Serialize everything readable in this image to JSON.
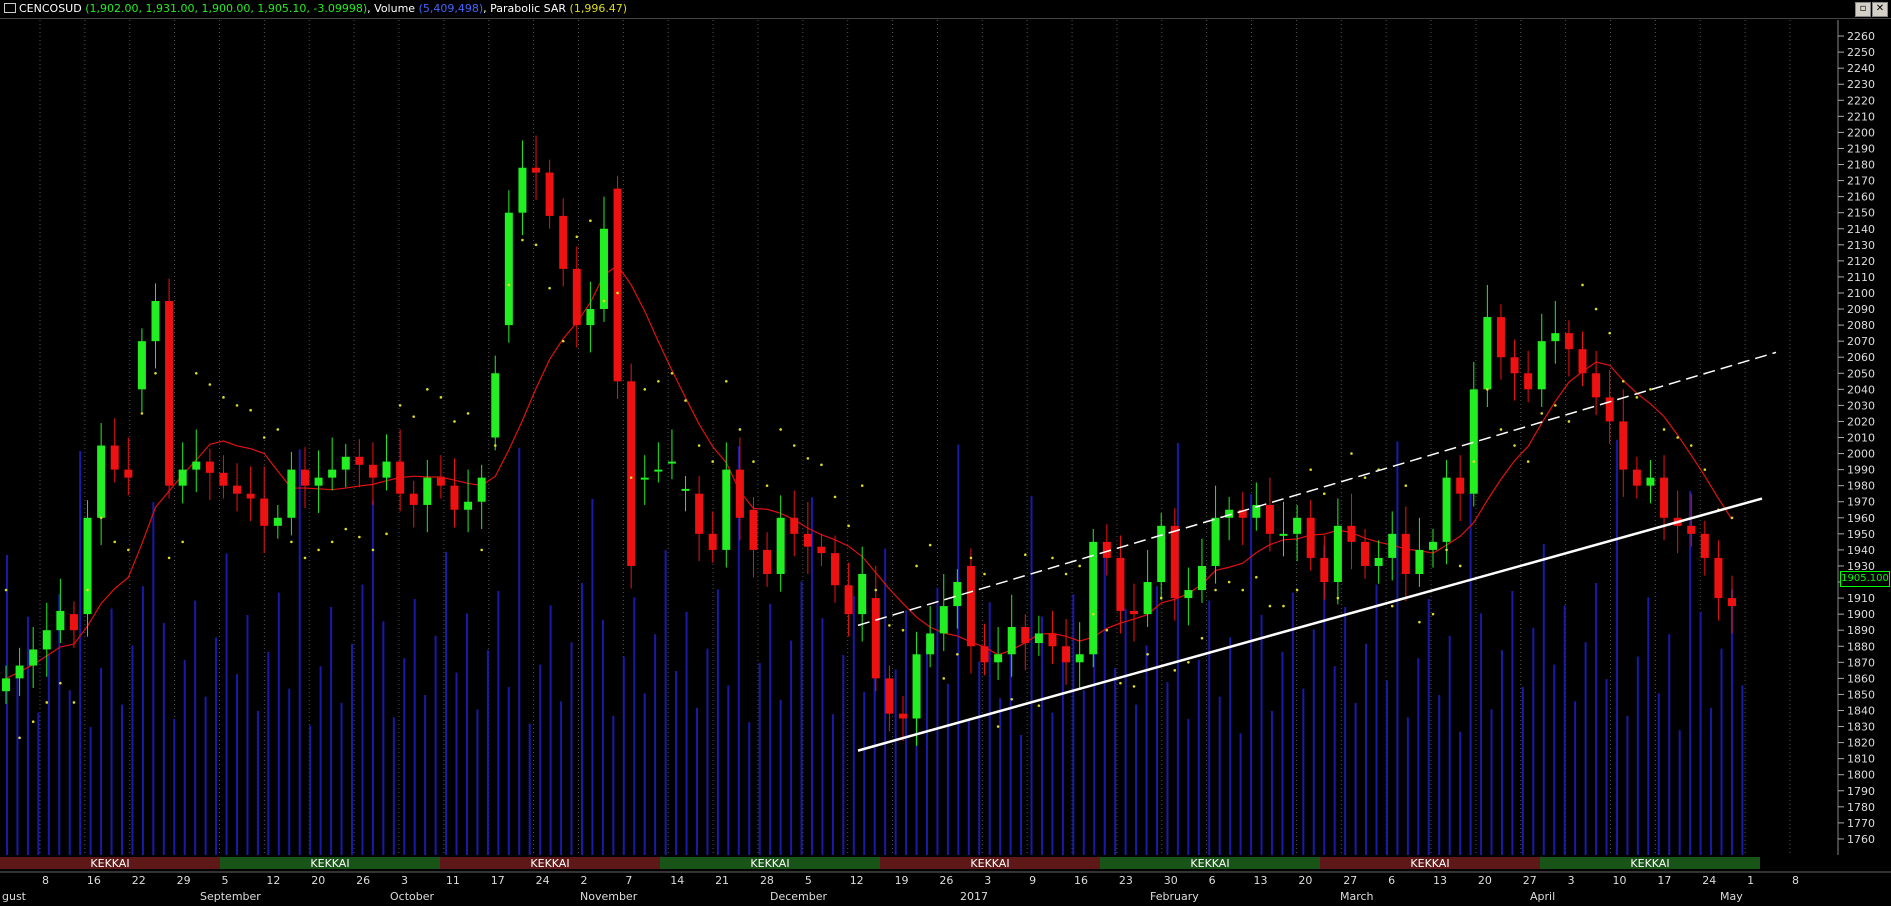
{
  "window": {
    "symbol": "CENCOSUD",
    "ohlc_text": "(1,902.00, 1,931.00, 1,900.00, 1,905.10, -3.09998)",
    "volume_label": "Volume",
    "volume_value": "(5,409,498)",
    "sar_label": "Parabolic SAR",
    "sar_value": "(1,996.47)",
    "close_icon": "close-icon",
    "restore_icon": "restore-icon"
  },
  "price_tag": "1905.100",
  "colors": {
    "up": "#22ee22",
    "down": "#ee1111",
    "blue": "#2222ff",
    "volume": "#1a1aaa",
    "ma": "#dd1111",
    "sar": "#dddd22",
    "trend": "#ffffff",
    "grid": "#555555",
    "kekkai_green": "#1d7a1d",
    "kekkai_red": "#8a1d1d"
  },
  "chart_data": {
    "type": "candlestick",
    "ylim": [
      1750,
      2270
    ],
    "y_ticks": [
      1760,
      1770,
      1780,
      1790,
      1800,
      1810,
      1820,
      1830,
      1840,
      1850,
      1860,
      1870,
      1880,
      1890,
      1900,
      1910,
      1920,
      1930,
      1940,
      1950,
      1960,
      1970,
      1980,
      1990,
      2000,
      2010,
      2020,
      2030,
      2040,
      2050,
      2060,
      2070,
      2080,
      2090,
      2100,
      2110,
      2120,
      2130,
      2140,
      2150,
      2160,
      2170,
      2180,
      2190,
      2200,
      2210,
      2220,
      2230,
      2240,
      2250,
      2260
    ],
    "x_day_ticks": [
      "8",
      "16",
      "22",
      "29",
      "5",
      "12",
      "20",
      "26",
      "3",
      "11",
      "17",
      "24",
      "2",
      "7",
      "14",
      "21",
      "28",
      "5",
      "12",
      "19",
      "26",
      "3",
      "9",
      "16",
      "23",
      "30",
      "6",
      "13",
      "20",
      "27",
      "6",
      "13",
      "20",
      "27",
      "3",
      "10",
      "17",
      "24",
      "1",
      "8"
    ],
    "x_month_ticks": [
      "gust",
      "September",
      "October",
      "November",
      "December",
      "2017",
      "February",
      "March",
      "April",
      "May"
    ],
    "kekkai_bands": [
      {
        "label": "KEKKAI",
        "color": "red"
      },
      {
        "label": "KEKKAI",
        "color": "green"
      },
      {
        "label": "KEKKAI",
        "color": "red"
      },
      {
        "label": "KEKKAI",
        "color": "green"
      },
      {
        "label": "KEKKAI",
        "color": "red"
      },
      {
        "label": "KEKKAI",
        "color": "green"
      },
      {
        "label": "KEKKAI",
        "color": "red"
      },
      {
        "label": "KEKKAI",
        "color": "green"
      }
    ],
    "series": [
      {
        "name": "CENCOSUD",
        "kind": "ohlc",
        "close": [
          1860,
          1868,
          1878,
          1890,
          1902,
          1890,
          1960,
          2005,
          1990,
          1985,
          2070,
          2095,
          1980,
          1990,
          1995,
          1988,
          1980,
          1975,
          1972,
          1955,
          1960,
          1990,
          1980,
          1985,
          1990,
          1998,
          1993,
          1985,
          1995,
          1975,
          1968,
          1985,
          1980,
          1965,
          1970,
          1985,
          2050,
          2150,
          2178,
          2175,
          2148,
          2115,
          2080,
          2090,
          2140,
          2045,
          1930,
          1985,
          1990,
          1995,
          1978,
          1950,
          1940,
          1990,
          1960,
          1940,
          1925,
          1960,
          1950,
          1942,
          1938,
          1918,
          1900,
          1925,
          1860,
          1838,
          1835,
          1875,
          1888,
          1905,
          1920,
          1880,
          1870,
          1875,
          1892,
          1882,
          1888,
          1880,
          1870,
          1875,
          1945,
          1935,
          1902,
          1900,
          1920,
          1955,
          1910,
          1915,
          1930,
          1960,
          1965,
          1960,
          1968,
          1950,
          1950,
          1960,
          1935,
          1920,
          1955,
          1945,
          1930,
          1935,
          1950,
          1925,
          1940,
          1945,
          1985,
          1975,
          2040,
          2085,
          2060,
          2050,
          2040,
          2070,
          2075,
          2065,
          2050,
          2035,
          2020,
          1990,
          1980,
          1985,
          1960,
          1955,
          1950,
          1935,
          1910,
          1905
        ],
        "open": [
          1852,
          1860,
          1868,
          1878,
          1890,
          1900,
          1900,
          1960,
          2005,
          1990,
          2040,
          2070,
          2095,
          1980,
          1990,
          1995,
          1988,
          1980,
          1975,
          1972,
          1955,
          1960,
          1990,
          1980,
          1985,
          1990,
          1998,
          1993,
          1985,
          1995,
          1975,
          1968,
          1985,
          1980,
          1965,
          1970,
          2010,
          2080,
          2150,
          2178,
          2175,
          2148,
          2115,
          2080,
          2090,
          2165,
          2045,
          1985,
          1990,
          1995,
          1978,
          1975,
          1950,
          1940,
          1990,
          1965,
          1940,
          1925,
          1960,
          1950,
          1942,
          1938,
          1918,
          1900,
          1910,
          1860,
          1838,
          1835,
          1875,
          1888,
          1905,
          1930,
          1880,
          1870,
          1875,
          1892,
          1882,
          1888,
          1880,
          1870,
          1875,
          1945,
          1935,
          1902,
          1900,
          1920,
          1955,
          1910,
          1915,
          1930,
          1960,
          1965,
          1960,
          1968,
          1950,
          1950,
          1960,
          1935,
          1920,
          1955,
          1945,
          1930,
          1935,
          1950,
          1925,
          1940,
          1945,
          1985,
          1975,
          2040,
          2085,
          2060,
          2050,
          2040,
          2070,
          2075,
          2065,
          2050,
          2035,
          2020,
          1990,
          1980,
          1985,
          1960,
          1955,
          1950,
          1935,
          1910
        ]
      },
      {
        "name": "MA",
        "kind": "line"
      },
      {
        "name": "Parabolic SAR",
        "kind": "dots"
      },
      {
        "name": "Volume",
        "kind": "bars"
      }
    ]
  }
}
